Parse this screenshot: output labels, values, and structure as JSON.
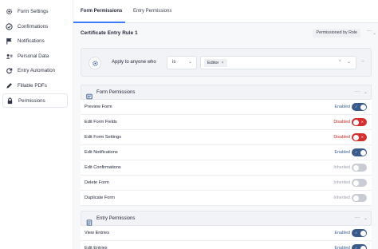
{
  "sidebar": {
    "items": [
      {
        "label": "Form Settings",
        "icon": "gear-icon"
      },
      {
        "label": "Confirmations",
        "icon": "check-circle-icon"
      },
      {
        "label": "Notifications",
        "icon": "flag-icon"
      },
      {
        "label": "Personal Data",
        "icon": "user-id-icon"
      },
      {
        "label": "Entry Automation",
        "icon": "refresh-icon"
      },
      {
        "label": "Fillable PDFs",
        "icon": "pen-icon"
      },
      {
        "label": "Permissions",
        "icon": "lock-icon",
        "active": true
      }
    ]
  },
  "tabs": {
    "form_permissions": "Form Permissions",
    "entry_permissions": "Entry Permissions"
  },
  "rule": {
    "title": "Certificate Entry Rule 1",
    "badge": "Permissioned by Role",
    "condition": {
      "label": "Apply to anyone who",
      "operator": "is",
      "value_tag": "Editor",
      "tag_remove": "×",
      "clear": "×"
    }
  },
  "form_permissions": {
    "title": "Form Permissions",
    "rows": [
      {
        "label": "Preview Form",
        "status": "Enabled",
        "state": "on"
      },
      {
        "label": "Edit Form Fields",
        "status": "Disabled",
        "state": "off"
      },
      {
        "label": "Edit Form Settings",
        "status": "Disabled",
        "state": "off"
      },
      {
        "label": "Edit Notifications",
        "status": "Enabled",
        "state": "on"
      },
      {
        "label": "Edit Confirmations",
        "status": "Inherited",
        "state": "inherited"
      },
      {
        "label": "Delete Form",
        "status": "Inherited",
        "state": "inherited"
      },
      {
        "label": "Duplicate Form",
        "status": "Inherited",
        "state": "inherited"
      }
    ]
  },
  "entry_permissions": {
    "title": "Entry Permissions",
    "rows": [
      {
        "label": "View Entries",
        "status": "Enabled",
        "state": "on"
      },
      {
        "label": "Edit Entries",
        "status": "Enabled",
        "state": "on"
      }
    ]
  },
  "colors": {
    "enabled": "#3a5a8c",
    "enabled_text": "#3e5f93",
    "disabled": "#d42f2f",
    "disabled_text": "#c62828",
    "inherited": "#c9ccd3",
    "inherited_text": "#9aa0ad",
    "accent": "#3e7bfa"
  }
}
